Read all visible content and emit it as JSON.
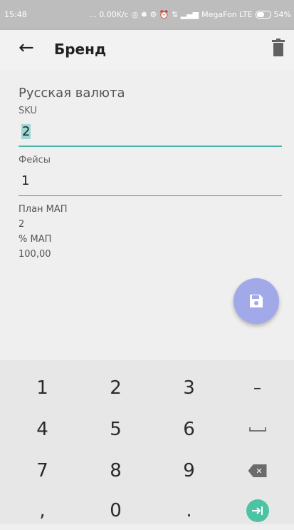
{
  "status_bar": {
    "time": "15:48",
    "net_speed": "... 0.00K/c",
    "carrier": "MegaFon LTE",
    "battery": "54%"
  },
  "app_bar": {
    "title": "Бренд"
  },
  "form": {
    "brand_name": "Русская валюта",
    "sku_label": "SKU",
    "sku_value": "2",
    "facings_label": "Фейсы",
    "facings_value": "1",
    "plan_map_label": "План МАП",
    "plan_map_value": "2",
    "percent_map_label": "% МАП",
    "percent_map_value": "100,00"
  },
  "keyboard": {
    "rows": [
      [
        "1",
        "2",
        "3",
        "–"
      ],
      [
        "4",
        "5",
        "6",
        "space"
      ],
      [
        "7",
        "8",
        "9",
        "delete"
      ],
      [
        ",",
        "0",
        ".",
        "enter"
      ]
    ]
  },
  "colors": {
    "accent": "#4db6ac",
    "fab": "#a1a9e8",
    "enter_key": "#4bc4a3"
  }
}
